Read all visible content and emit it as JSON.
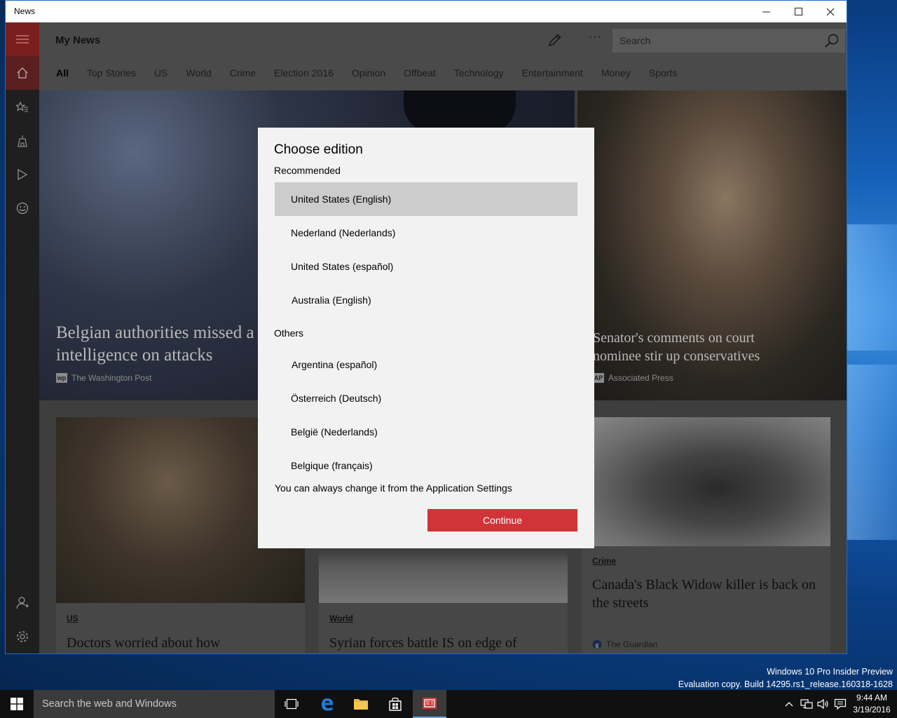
{
  "window": {
    "title": "News"
  },
  "app": {
    "title": "My News",
    "search_placeholder": "Search",
    "more_label": "···",
    "tabs": [
      "All",
      "Top Stories",
      "US",
      "World",
      "Crime",
      "Election 2016",
      "Opinion",
      "Offbeat",
      "Technology",
      "Entertainment",
      "Money",
      "Sports"
    ],
    "active_tab": "All"
  },
  "rail": {
    "items": [
      "home-icon",
      "favorites-icon",
      "local-icon",
      "video-icon",
      "emoji-icon"
    ],
    "bottom": [
      "account-icon",
      "settings-icon"
    ]
  },
  "heroes": [
    {
      "headline": "Belgian authorities missed a\nintelligence on attacks",
      "source": "The Washington Post",
      "logo": "wp"
    },
    {
      "headline": "Senator's comments on court\nnominee stir up conservatives",
      "source": "Associated Press",
      "logo": "AP"
    }
  ],
  "cards": [
    {
      "category": "US",
      "headline": "Doctors worried about how"
    },
    {
      "category": "World",
      "headline": "Syrian forces battle IS on edge of"
    },
    {
      "category": "Crime",
      "headline": "Canada's Black Widow killer is back on the streets",
      "source": "The Guardian"
    }
  ],
  "dialog": {
    "title": "Choose edition",
    "recommended_label": "Recommended",
    "recommended": [
      "United States (English)",
      "Nederland (Nederlands)",
      "United States (español)",
      "Australia (English)"
    ],
    "selected": "United States (English)",
    "others_label": "Others",
    "others": [
      "Argentina (español)",
      "Österreich (Deutsch)",
      "België (Nederlands)",
      "Belgique (français)"
    ],
    "note": "You can always change it from the Application Settings",
    "continue_label": "Continue",
    "accent": "#d13438"
  },
  "desktop": {
    "watermark_line1": "Windows 10 Pro Insider Preview",
    "watermark_line2": "Evaluation copy. Build 14295.rs1_release.160318-1628"
  },
  "taskbar": {
    "search_placeholder": "Search the web and Windows",
    "time": "9:44 AM",
    "date": "3/19/2016"
  }
}
